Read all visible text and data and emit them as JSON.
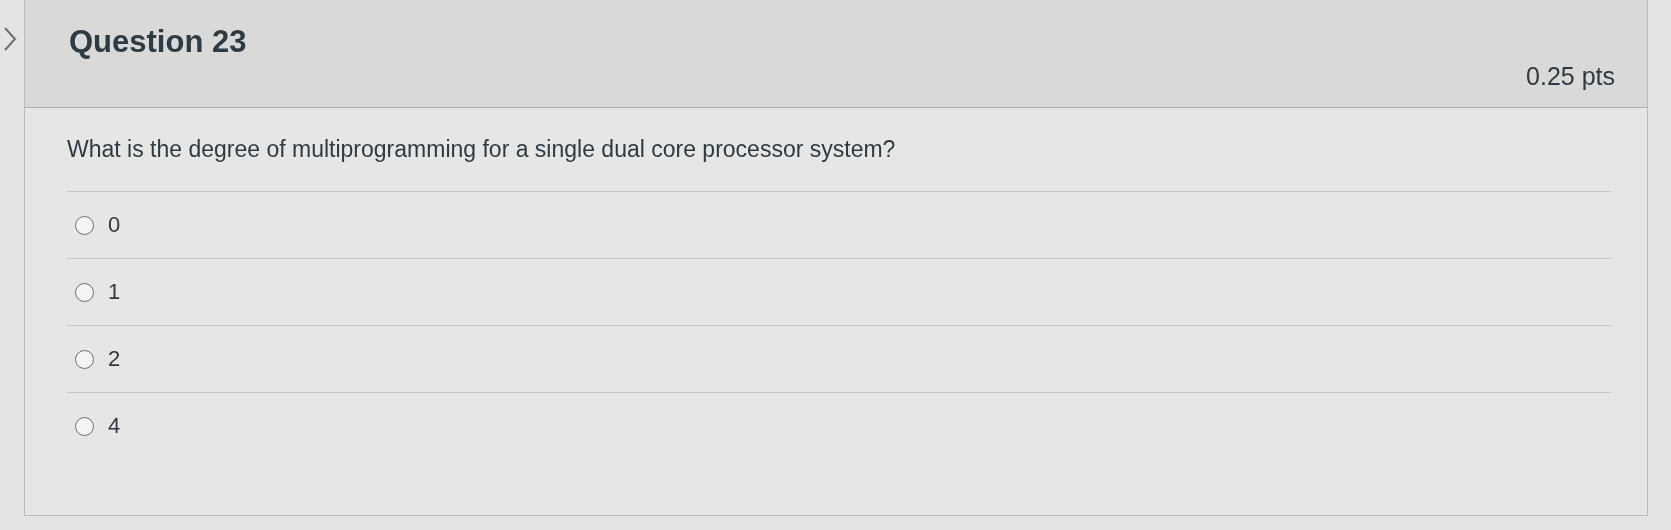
{
  "question": {
    "title": "Question 23",
    "points": "0.25 pts",
    "text": "What is the degree of multiprogramming for a single dual core processor system?",
    "answers": [
      {
        "label": "0",
        "selected": false
      },
      {
        "label": "1",
        "selected": false
      },
      {
        "label": "2",
        "selected": false
      },
      {
        "label": "4",
        "selected": false
      }
    ]
  }
}
